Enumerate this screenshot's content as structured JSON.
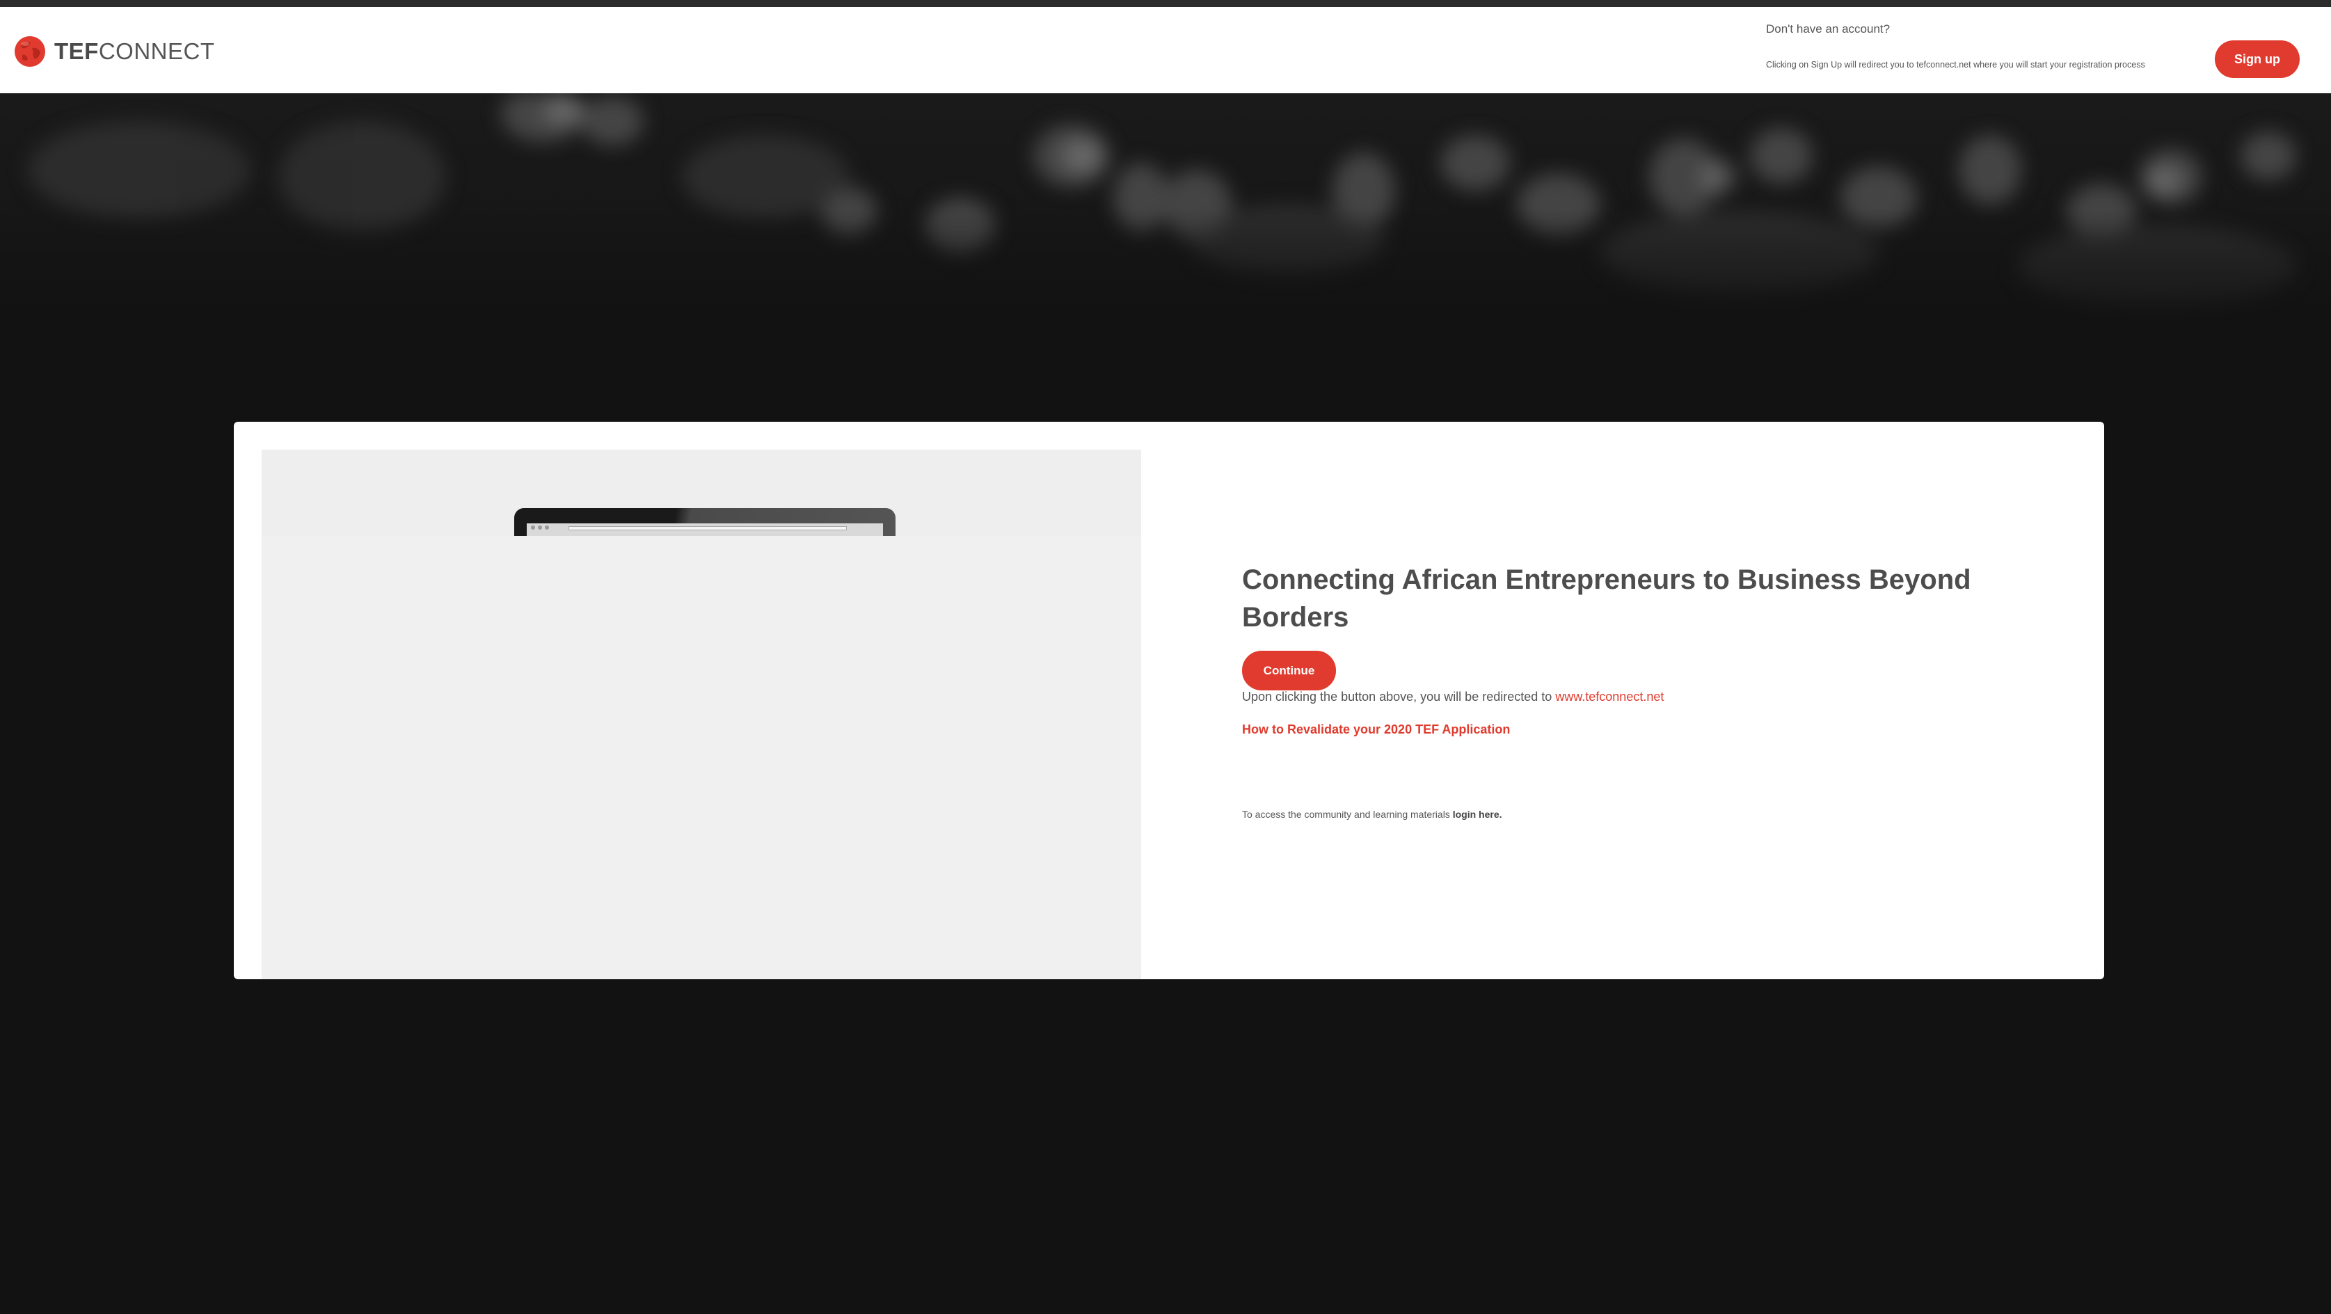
{
  "header": {
    "logo": {
      "brand_bold": "TEF",
      "brand_regular": "CONNECT",
      "icon": "globe-icon"
    },
    "no_account_text": "Don't have an account?",
    "redirect_note": "Clicking on Sign Up will redirect you to tefconnect.net where you will start your registration process",
    "signup_label": "Sign up"
  },
  "hero": {
    "image": "blurred crowd of attendees"
  },
  "card": {
    "media": {
      "image": "laptop showing a browser window"
    },
    "headline": "Connecting African Entrepreneurs to Business Beyond Borders",
    "continue_label": "Continue",
    "redirect_prefix": "Upon clicking the button above, you will be redirected to ",
    "redirect_link": "www.tefconnect.net",
    "revalidate_link": "How to Revalidate your 2020 TEF Application",
    "access_prefix": "To access the community and learning materials ",
    "login_link": "login here."
  },
  "colors": {
    "accent": "#e03b2e",
    "page_background": "#121212",
    "header_background": "#ffffff",
    "text": "#555555"
  }
}
